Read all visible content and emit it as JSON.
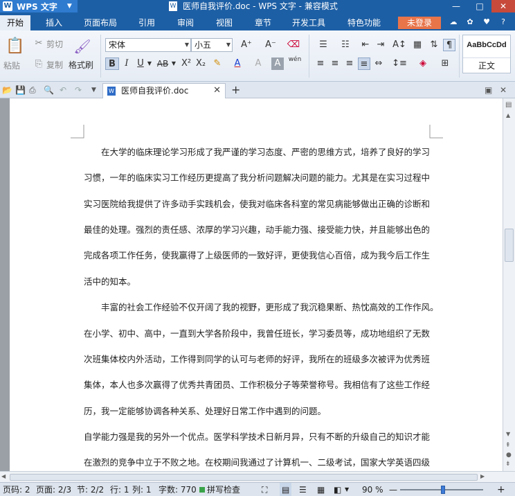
{
  "titlebar": {
    "app_menu_label": "WPS 文字",
    "document_title": "医师自我评价.doc - WPS 文字 - 兼容模式",
    "window_controls": {
      "minimize": "—",
      "maximize": "□",
      "close": "✕"
    }
  },
  "menu_tabs": [
    {
      "label": "开始",
      "active": true
    },
    {
      "label": "插入",
      "active": false
    },
    {
      "label": "页面布局",
      "active": false
    },
    {
      "label": "引用",
      "active": false
    },
    {
      "label": "审阅",
      "active": false
    },
    {
      "label": "视图",
      "active": false
    },
    {
      "label": "章节",
      "active": false
    },
    {
      "label": "开发工具",
      "active": false
    },
    {
      "label": "特色功能",
      "active": false
    }
  ],
  "login_label": "未登录",
  "ribbon": {
    "paste_label": "粘贴",
    "cut_label": "剪切",
    "copy_label": "复制",
    "format_painter_label": "格式刷",
    "font_name": "宋体",
    "font_size": "小五",
    "style_preview": "AaBbCcDd",
    "style_name": "正文",
    "grow_font": "A⁺",
    "shrink_font": "A⁻",
    "bold": "B",
    "italic": "I",
    "underline": "U",
    "strikethrough": "AB",
    "superscript": "X²",
    "subscript": "X₂",
    "font_color": "A",
    "phonetic": "wén"
  },
  "doc_tab": {
    "filename": "医师自我评价.doc",
    "close": "✕",
    "new_tab": "+"
  },
  "document": {
    "lines": [
      "　　在大学的临床理论学习形成了我严谨的学习态度、严密的思维方式，培养了良好的学习",
      "习惯，一年的临床实习工作经历更提高了我分析问题解决问题的能力。尤其是在实习过程中",
      "实习医院给我提供了许多动手实践机会，使我对临床各科室的常见病能够做出正确的诊断和",
      "最佳的处理。强烈的责任感、浓厚的学习兴趣，动手能力强、接受能力快，并且能够出色的",
      "完成各项工作任务，使我赢得了上级医师的一致好评，更使我信心百倍，成为我今后工作生",
      "活中的知本。",
      "　　丰富的社会工作经验不仅开阔了我的视野，更形成了我沉稳果断、热忱高效的工作作风。",
      "在小学、初中、高中，一直到大学各阶段中，我曾任班长，学习委员等，成功地组织了无数",
      "次班集体校内外活动，工作得到同学的认可与老师的好评，我所在的班级多次被评为优秀班",
      "集体，本人也多次赢得了优秀共青团员、工作积极分子等荣誉称号。我相信有了这些工作经",
      "历，我一定能够协调各种关系、处理好日常工作中遇到的问题。",
      "自学能力强是我的另外一个优点。医学科学技术日新月异，只有不断的升级自己的知识才能",
      "在激烈的竞争中立于不败之地。在校期间我通过了计算机一、二级考试，国家大学英语四级"
    ]
  },
  "statusbar": {
    "page_code": "页码: 2",
    "page": "页面: 2/3",
    "section": "节: 2/2",
    "row": "行: 1",
    "column": "列: 1",
    "word_count": "字数: 770",
    "spell_check": "拼写检查",
    "zoom": "90 %",
    "zoom_minus": "—",
    "zoom_plus": "+",
    "zoom_fraction": 0.52
  }
}
